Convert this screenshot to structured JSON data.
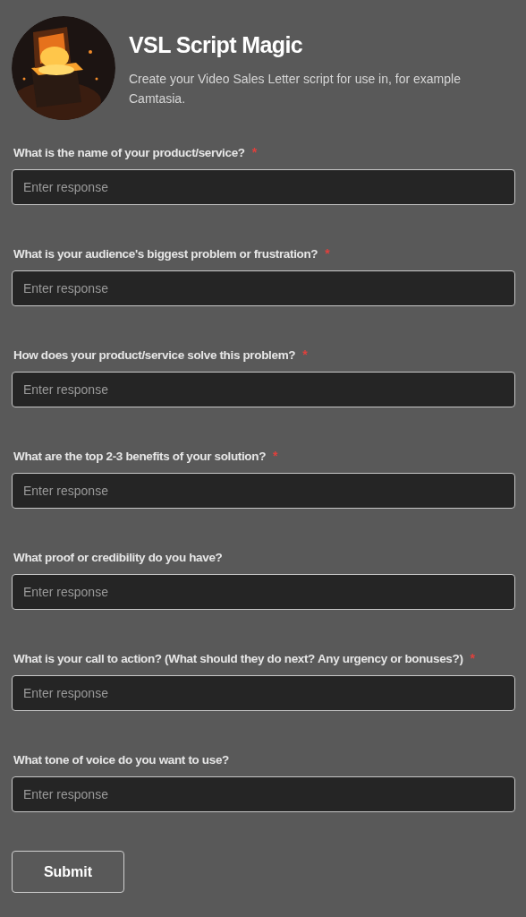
{
  "header": {
    "title": "VSL Script Magic",
    "description": "Create your Video Sales Letter script for use in, for example Camtasia."
  },
  "questions": [
    {
      "label": "What is the name of your product/service?",
      "required_mark": "*",
      "placeholder": "Enter response"
    },
    {
      "label": "What is your audience's biggest problem or frustration?",
      "required_mark": "*",
      "placeholder": "Enter response"
    },
    {
      "label": "How does your product/service solve this problem?",
      "required_mark": "*",
      "placeholder": "Enter response"
    },
    {
      "label": "What are the top 2-3 benefits of your solution?",
      "required_mark": "*",
      "placeholder": "Enter response"
    },
    {
      "label": "What proof or credibility do you have?",
      "placeholder": "Enter response"
    },
    {
      "label": "What is your call to action? (What should they do next? Any urgency or bonuses?)",
      "required_mark": "*",
      "placeholder": "Enter response"
    },
    {
      "label": "What tone of voice do you want to use?",
      "placeholder": "Enter response"
    }
  ],
  "submit": "Submit"
}
